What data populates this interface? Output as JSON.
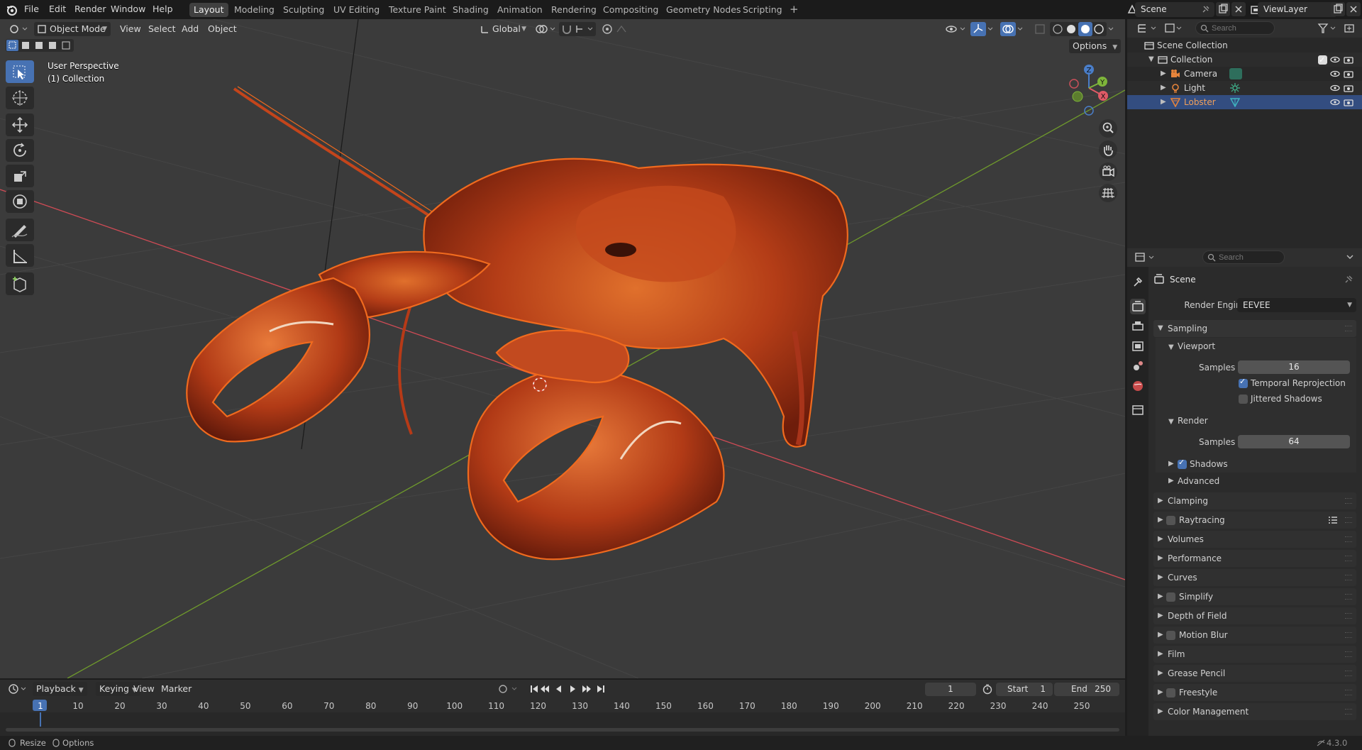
{
  "topbar": {
    "menus": [
      "File",
      "Edit",
      "Render",
      "Window",
      "Help"
    ],
    "workspaces": [
      "Layout",
      "Modeling",
      "Sculpting",
      "UV Editing",
      "Texture Paint",
      "Shading",
      "Animation",
      "Rendering",
      "Compositing",
      "Geometry Nodes",
      "Scripting"
    ],
    "active_workspace": "Layout",
    "add_workspace": "+",
    "scene_name": "Scene",
    "view_layer": "ViewLayer"
  },
  "viewport": {
    "mode": "Object Mode",
    "menus": [
      "View",
      "Select",
      "Add",
      "Object"
    ],
    "transform_orientation": "Global",
    "options_label": "Options",
    "perspective_label": "User Perspective",
    "collection_label": "(1) Collection",
    "gizmo_axes": {
      "x": "X",
      "y": "Y",
      "z": "Z"
    },
    "colors": {
      "background": "#3b3b3b",
      "selection_outline": "#f06a1e",
      "x_axis": "#d4515a",
      "y_axis": "#7ea335"
    }
  },
  "outliner": {
    "search_placeholder": "Search",
    "root": "Scene Collection",
    "collection": "Collection",
    "items": [
      {
        "name": "Camera",
        "icon": "camera-icon",
        "selected": false
      },
      {
        "name": "Light",
        "icon": "light-icon",
        "selected": false
      },
      {
        "name": "Lobster",
        "icon": "mesh-icon",
        "selected": true
      }
    ]
  },
  "properties": {
    "search_placeholder": "Search",
    "context": "Scene",
    "render_engine_label": "Render Engine",
    "render_engine_value": "EEVEE",
    "sampling": {
      "title": "Sampling",
      "viewport": {
        "title": "Viewport",
        "samples_label": "Samples",
        "samples": "16",
        "temporal_reprojection": "Temporal Reprojection",
        "jittered_shadows": "Jittered Shadows"
      },
      "render": {
        "title": "Render",
        "samples_label": "Samples",
        "samples": "64",
        "shadows": "Shadows",
        "advanced": "Advanced"
      }
    },
    "panels": [
      "Clamping",
      "Raytracing",
      "Volumes",
      "Performance",
      "Curves",
      "Simplify",
      "Depth of Field",
      "Motion Blur",
      "Film",
      "Grease Pencil",
      "Freestyle",
      "Color Management"
    ]
  },
  "timeline": {
    "menus": [
      "Playback",
      "Keying",
      "View",
      "Marker"
    ],
    "current_frame": "1",
    "start_label": "Start",
    "start": "1",
    "end_label": "End",
    "end": "250",
    "ticks": [
      "1",
      "10",
      "20",
      "30",
      "40",
      "50",
      "60",
      "70",
      "80",
      "90",
      "100",
      "110",
      "120",
      "130",
      "140",
      "150",
      "160",
      "170",
      "180",
      "190",
      "200",
      "210",
      "220",
      "230",
      "240",
      "250"
    ]
  },
  "statusbar": {
    "left_1": "Resize",
    "left_2": "Options",
    "version": "4.3.0"
  }
}
